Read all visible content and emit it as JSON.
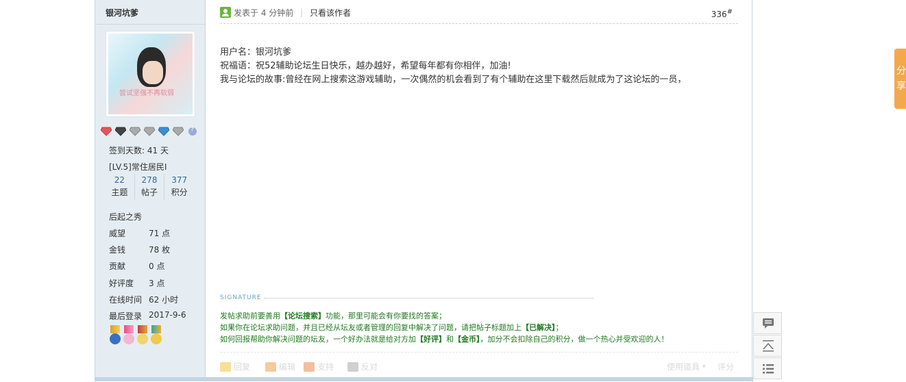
{
  "author": {
    "name": "银河坑爹",
    "avatar_text": "尝试坚强不再软弱",
    "sign_days": "签到天数: 41 天",
    "level": "[LV.5]常住居民I",
    "counts": [
      {
        "num": "22",
        "label": "主题"
      },
      {
        "num": "278",
        "label": "帖子"
      },
      {
        "num": "377",
        "label": "积分"
      }
    ],
    "group": "后起之秀",
    "fields": [
      {
        "k": "威望",
        "v": "71 点"
      },
      {
        "k": "金钱",
        "v": "78 枚"
      },
      {
        "k": "贡献",
        "v": "0 点"
      },
      {
        "k": "好评度",
        "v": "3 点"
      },
      {
        "k": "在线时间",
        "v": "62 小时"
      },
      {
        "k": "最后登录",
        "v": "2017-9-6"
      }
    ],
    "help_icon": "?"
  },
  "post": {
    "posted_label": "发表于 4 分钟前",
    "separator": "|",
    "author_only": "只看该作者",
    "floor": "336",
    "floor_suffix": "#",
    "lines": [
      "用户名：银河坑爹",
      "祝福语：祝52辅助论坛生日快乐，越办越好，希望每年都有你相伴，加油!",
      "我与论坛的故事:曾经在网上搜索这游戏辅助，一次偶然的机会看到了有个辅助在这里下载然后就成为了这论坛的一员，"
    ]
  },
  "signature": {
    "label": "SIGNATURE",
    "l1_a": "发帖求助前要善用",
    "l1_b": "【论坛搜索】",
    "l1_c": "功能，那里可能会有你要找的答案；",
    "l2_a": "如果你在论坛求助问题，并且已经从坛友或者管理的回复中解决了问题，请把帖子标题加上",
    "l2_b": "【已解决】",
    "l2_c": "；",
    "l3_a": "如何回报帮助你解决问题的坛友，一个好办法就是给对方加",
    "l3_b": "【好评】",
    "l3_c": "和",
    "l3_d": "【金币】",
    "l3_e": "，加分不会扣除自己的积分，做一个热心并受欢迎的人！"
  },
  "actions": {
    "reply": "回复",
    "edit": "编辑",
    "support": "支持",
    "oppose": "反对",
    "tools": "使用道具",
    "rate": "评分"
  },
  "share_tab": "分享",
  "colors": {
    "accent": "#f3a94b",
    "sidebar": "#e5edf2",
    "sig_green": "#1f7a1f"
  }
}
